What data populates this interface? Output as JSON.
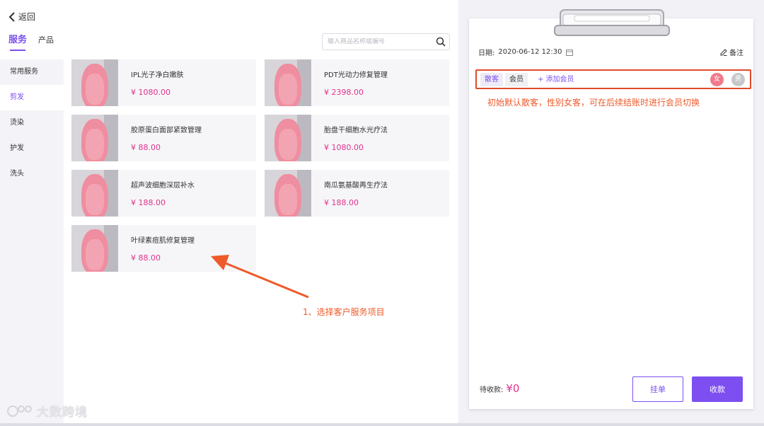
{
  "header": {
    "back_label": "返回",
    "tabs": [
      {
        "label": "服务",
        "active": true
      },
      {
        "label": "产品",
        "active": false
      }
    ],
    "search_placeholder": "输入商品名称或编号"
  },
  "sidebar": {
    "items": [
      {
        "label": "常用服务",
        "active": false
      },
      {
        "label": "剪发",
        "active": true
      },
      {
        "label": "烫染",
        "active": false
      },
      {
        "label": "护发",
        "active": false
      },
      {
        "label": "洗头",
        "active": false
      }
    ]
  },
  "products": [
    {
      "name": "IPL光子净白嫩肤",
      "price": "¥ 1080.00"
    },
    {
      "name": "PDT光动力修复管理",
      "price": "¥ 2398.00"
    },
    {
      "name": "胶原蛋白面部紧致管理",
      "price": "¥ 88.00"
    },
    {
      "name": "胎盘干细胞水光疗法",
      "price": "¥ 1080.00"
    },
    {
      "name": "超声波细胞深层补水",
      "price": "¥ 188.00"
    },
    {
      "name": "南瓜氨基酸再生疗法",
      "price": "¥ 188.00"
    },
    {
      "name": "叶绿素痘肌修复管理",
      "price": "¥ 88.00"
    }
  ],
  "annotations": {
    "step1": "1、选择客户服务项目",
    "customer_note": "初始默认散客，性别女客，可在后续结账时进行会员切换"
  },
  "order": {
    "date_label": "日期:",
    "date_value": "2020-06-12 12:30",
    "remark_label": "备注",
    "customer_types": [
      "散客",
      "会员"
    ],
    "add_member": "+ 添加会员",
    "gender_female": "女",
    "gender_male": "男",
    "pending_label": "待收款:",
    "pending_amount": "¥0",
    "hold_button": "挂单",
    "pay_button": "收款"
  },
  "watermark": "大数跨境",
  "colors": {
    "accent": "#7b4ff0",
    "price": "#e0338a",
    "annotation": "#ee5a2a",
    "female": "#f07a8a"
  }
}
